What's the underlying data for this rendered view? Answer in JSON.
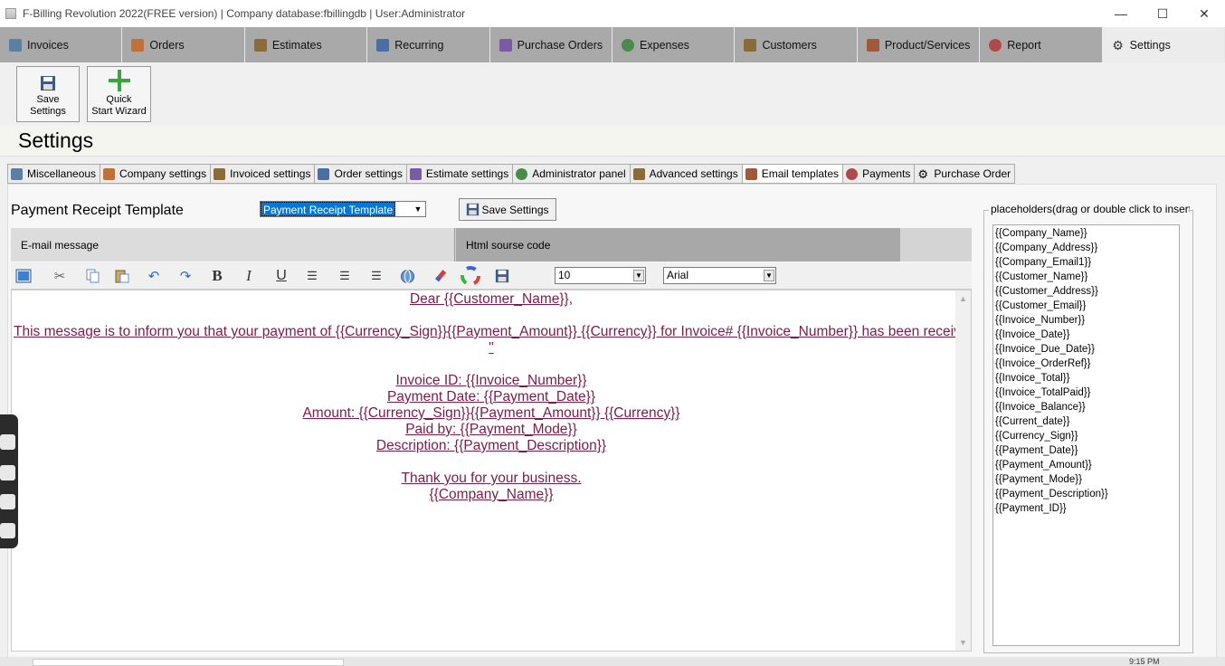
{
  "window": {
    "title": "F-Billing Revolution 2022(FREE version) | Company database:fbillingdb | User:Administrator",
    "minimize": "—",
    "maximize": "☐",
    "close": "✕"
  },
  "main_tabs": [
    {
      "label": "Invoices",
      "icon": "invoice-icon",
      "color": "#5b7fa3"
    },
    {
      "label": "Orders",
      "icon": "orders-box-icon",
      "color": "#c0703a"
    },
    {
      "label": "Estimates",
      "icon": "estimates-icon",
      "color": "#8a6b3a"
    },
    {
      "label": "Recurring",
      "icon": "recurring-icon",
      "color": "#4a6fa5"
    },
    {
      "label": "Purchase Orders",
      "icon": "purchase-orders-icon",
      "color": "#7a5aa5"
    },
    {
      "label": "Expenses",
      "icon": "expenses-icon",
      "color": "#4a8a4a"
    },
    {
      "label": "Customers",
      "icon": "customers-icon",
      "color": "#8a6b3a"
    },
    {
      "label": "Product/Services",
      "icon": "product-services-icon",
      "color": "#a05a3a"
    },
    {
      "label": "Report",
      "icon": "report-icon",
      "color": "#b04a4a"
    },
    {
      "label": "Settings",
      "icon": "settings-gear-icon",
      "color": "#333333"
    }
  ],
  "ribbon": {
    "save_settings": "Save\nSettings",
    "quick_start": "Quick\nStart Wizard"
  },
  "page_title": "Settings",
  "sub_tabs": [
    {
      "label": "Miscellaneous",
      "icon": "misc-icon",
      "color": "#5b7fa3"
    },
    {
      "label": "Company settings",
      "icon": "company-icon",
      "color": "#c0703a"
    },
    {
      "label": "Invoiced settings",
      "icon": "invoice-settings-icon",
      "color": "#8a6b3a"
    },
    {
      "label": "Order settings",
      "icon": "order-settings-icon",
      "color": "#4a6fa5"
    },
    {
      "label": "Estimate settings",
      "icon": "estimate-settings-icon",
      "color": "#7a5aa5"
    },
    {
      "label": "Administrator panel",
      "icon": "admin-panel-icon",
      "color": "#4a8a4a"
    },
    {
      "label": "Advanced settings",
      "icon": "advanced-settings-icon",
      "color": "#8a6b3a"
    },
    {
      "label": "Email templates",
      "icon": "email-templates-icon",
      "color": "#a05a3a"
    },
    {
      "label": "Payments",
      "icon": "payments-icon",
      "color": "#b04a4a"
    },
    {
      "label": "Purchase Order",
      "icon": "purchase-order-gear-icon",
      "color": "#333333"
    }
  ],
  "template": {
    "label": "Payment Receipt Template",
    "selected": "Payment Receipt Template",
    "save_button": "Save Settings"
  },
  "editor_tabs": {
    "email": "E-mail message",
    "html": "Html sourse code"
  },
  "toolbar": {
    "font_size": "10",
    "font_name": "Arial"
  },
  "email_body": {
    "greeting": "Dear {{Customer_Name}},",
    "message": "This message is to inform you that your payment of {{Currency_Sign}}{{Payment_Amount}} {{Currency}} for Invoice# {{Invoice_Number}} has been received.",
    "quote": "\"",
    "invoice_id": "Invoice ID: {{Invoice_Number}}",
    "payment_date": "Payment Date: {{Payment_Date}}",
    "amount": "Amount: {{Currency_Sign}}{{Payment_Amount}} {{Currency}}",
    "paid_by": "Paid by: {{Payment_Mode}}",
    "description": "Description: {{Payment_Description}}",
    "thanks": "Thank you for your business.",
    "signature": "{{Company_Name}}",
    "text_color": "#7a1c4a"
  },
  "placeholders": {
    "title": "placeholders(drag or double click to insert)",
    "items": [
      "{{Company_Name}}",
      "{{Company_Address}}",
      "{{Company_Email1}}",
      "{{Customer_Name}}",
      "{{Customer_Address}}",
      "{{Customer_Email}}",
      "{{Invoice_Number}}",
      "{{Invoice_Date}}",
      "{{Invoice_Due_Date}}",
      "{{Invoice_OrderRef}}",
      "{{Invoice_Total}}",
      "{{Invoice_TotalPaid}}",
      "{{Invoice_Balance}}",
      "{{Current_date}}",
      "{{Currency_Sign}}",
      "{{Payment_Date}}",
      "{{Payment_Amount}}",
      "{{Payment_Mode}}",
      "{{Payment_Description}}",
      "{{Payment_ID}}"
    ]
  },
  "taskbar": {
    "clock": "9:15 PM"
  }
}
